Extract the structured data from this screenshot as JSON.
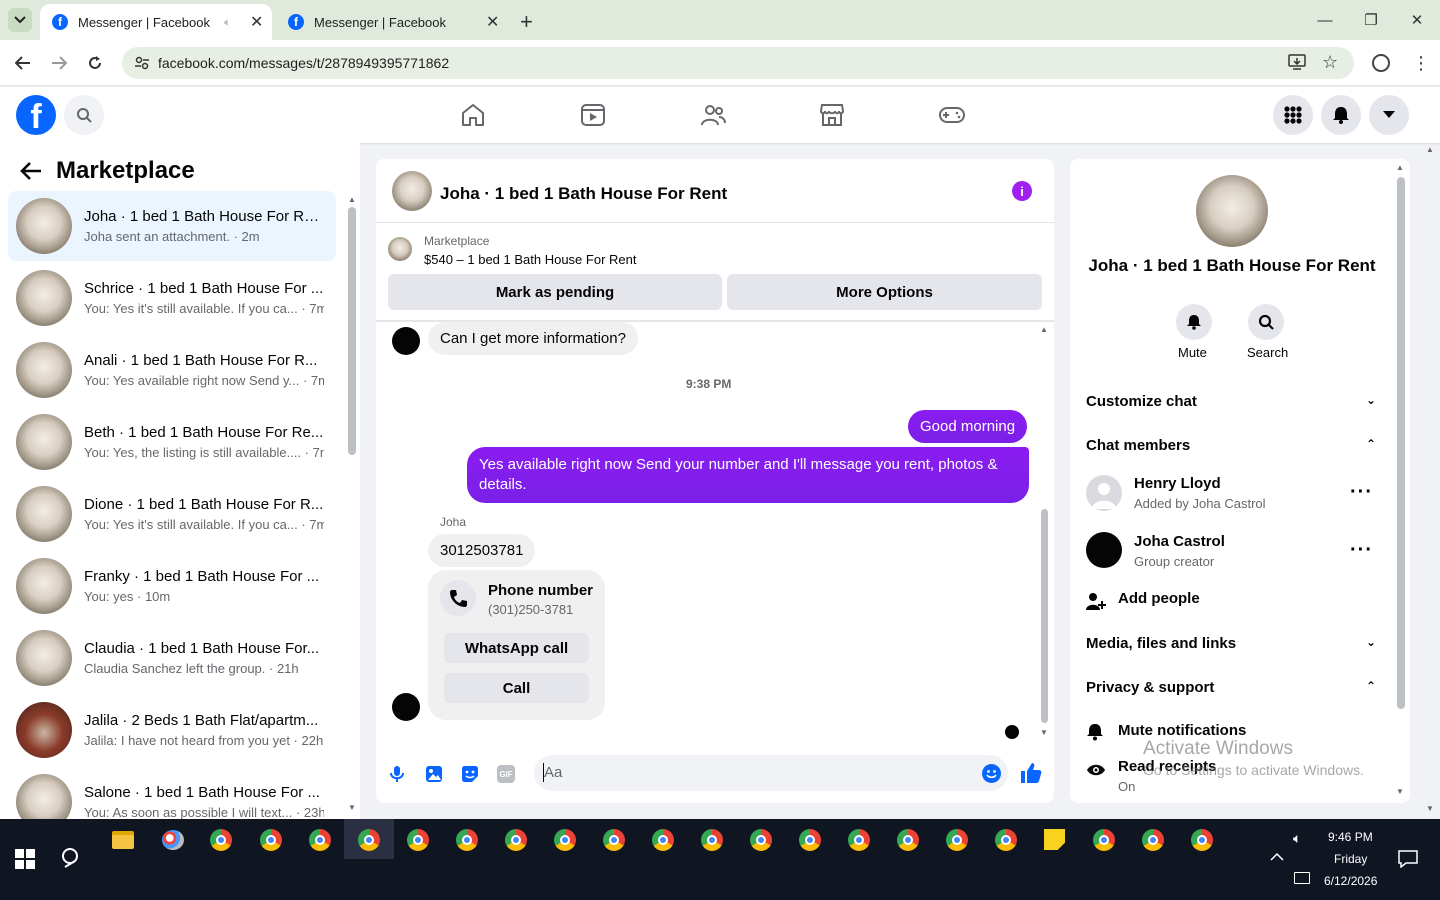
{
  "browser": {
    "tabs": [
      {
        "title": "Messenger | Facebook",
        "active": true
      },
      {
        "title": "Messenger | Facebook",
        "active": false
      }
    ],
    "url": "facebook.com/messages/t/2878949395771862"
  },
  "left_panel": {
    "title": "Marketplace",
    "conversations": [
      {
        "title": "Joha · 1 bed 1 Bath House For Re...",
        "snippet": "Joha sent an attachment. · 2m",
        "selected": true
      },
      {
        "title": "Schrice · 1 bed 1 Bath House For ...",
        "snippet": "You: Yes it's still available. If you ca... · 7m"
      },
      {
        "title": "Anali · 1 bed 1 Bath House For R...",
        "snippet": "You: Yes available right now Send y... · 7m"
      },
      {
        "title": "Beth · 1 bed 1 Bath House For Re...",
        "snippet": "You: Yes, the listing is still available.... · 7m"
      },
      {
        "title": "Dione · 1 bed 1 Bath House For R...",
        "snippet": "You: Yes it's still available. If you ca... · 7m"
      },
      {
        "title": "Franky · 1 bed 1 Bath House For ...",
        "snippet": "You: yes · 10m"
      },
      {
        "title": "Claudia · 1 bed 1 Bath House For...",
        "snippet": "Claudia Sanchez left the group. · 21h"
      },
      {
        "title": "Jalila · 2 Beds 1 Bath Flat/apartm...",
        "snippet": "Jalila: I have not heard from you yet · 22h"
      },
      {
        "title": "Salone · 1 bed 1 Bath House For ...",
        "snippet": "You: As soon as possible I will text... · 23h"
      }
    ]
  },
  "chat": {
    "title": "Joha · 1 bed 1 Bath House For Rent",
    "listing_source": "Marketplace",
    "listing_title": "$540 – 1 bed 1 Bath House For Rent",
    "mark_pending_label": "Mark as pending",
    "more_options_label": "More Options",
    "msg_info_request": "Can I get more information?",
    "timestamp": "9:38 PM",
    "msg_good_morning": "Good morning",
    "msg_available": "Yes available right now Send your number and I'll message you rent, photos & details.",
    "sender_name": "Joha",
    "msg_phone": "3012503781",
    "phone_card_title": "Phone number",
    "phone_card_number": "(301)250-3781",
    "whatsapp_label": "WhatsApp call",
    "call_label": "Call",
    "composer_placeholder": "Aa"
  },
  "details": {
    "name": "Joha · 1 bed 1 Bath House For Rent",
    "mute_label": "Mute",
    "search_label": "Search",
    "customize_label": "Customize chat",
    "members_label": "Chat members",
    "members": [
      {
        "name": "Henry Lloyd",
        "role": "Added by Joha Castrol"
      },
      {
        "name": "Joha Castrol",
        "role": "Group creator"
      }
    ],
    "add_people_label": "Add people",
    "media_label": "Media, files and links",
    "privacy_label": "Privacy & support",
    "mute_notifications_label": "Mute notifications",
    "read_receipts_label": "Read receipts",
    "read_receipts_value": "On"
  },
  "watermark": {
    "line1": "Activate Windows",
    "line2": "Go to Settings to activate Windows."
  },
  "taskbar": {
    "time": "9:46 PM",
    "day": "Friday",
    "date": "6/12/2026"
  },
  "colors": {
    "brand_blue": "#0866ff",
    "bubble_purple": "#7a20e8",
    "selected_row": "#ebf5ff"
  }
}
